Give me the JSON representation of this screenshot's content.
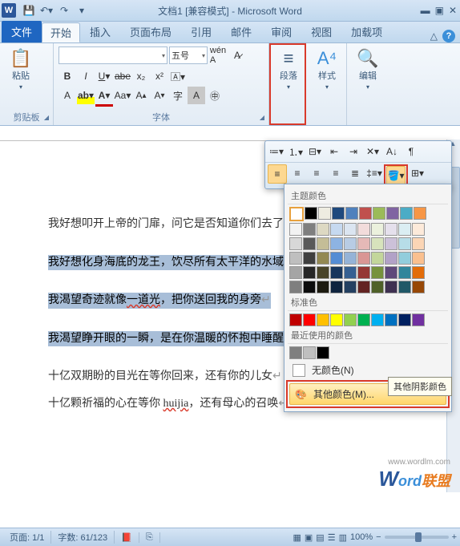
{
  "title": "文档1 [兼容模式] - Microsoft Word",
  "tabs": {
    "file": "文件",
    "home": "开始",
    "insert": "插入",
    "layout": "页面布局",
    "references": "引用",
    "mailings": "邮件",
    "review": "审阅",
    "view": "视图",
    "addins": "加载项"
  },
  "ribbon": {
    "clipboard": {
      "label": "剪贴板",
      "paste": "粘贴"
    },
    "font": {
      "label": "字体",
      "name": "",
      "size": "五号"
    },
    "paragraph": {
      "label": "段落"
    },
    "styles": {
      "label": "样式"
    },
    "editing": {
      "label": "编辑"
    }
  },
  "document": {
    "lines": [
      "我好想叩开上帝的门扉，问它是否知道你们去了何方",
      "我好想化身海底的龙王，饮尽所有太平洋的水域",
      "我渴望奇迹就像一道光，把你送回我的身旁",
      "我渴望睁开眼的一瞬，是在你温暖的怀抱中睡醒",
      "十亿双期盼的目光在等你回来，还有你的儿女",
      "十亿颗祈福的心在等你 huijia，还有母心的召唤"
    ]
  },
  "color_popup": {
    "theme_label": "主题颜色",
    "standard_label": "标准色",
    "recent_label": "最近使用的颜色",
    "no_color": "无颜色(N)",
    "more_colors": "其他颜色(M)...",
    "tooltip": "其他阴影颜色",
    "theme_row1": [
      "#ffffff",
      "#000000",
      "#eeece1",
      "#1f497d",
      "#4f81bd",
      "#c0504d",
      "#9bbb59",
      "#8064a2",
      "#4bacc6",
      "#f79646"
    ],
    "theme_shades": [
      [
        "#f2f2f2",
        "#7f7f7f",
        "#ddd9c3",
        "#c6d9f0",
        "#dbe5f1",
        "#f2dcdb",
        "#ebf1dd",
        "#e5e0ec",
        "#dbeef3",
        "#fdeada"
      ],
      [
        "#d8d8d8",
        "#595959",
        "#c4bd97",
        "#8db3e2",
        "#b8cce4",
        "#e5b9b7",
        "#d7e3bc",
        "#ccc1d9",
        "#b7dde8",
        "#fbd5b5"
      ],
      [
        "#bfbfbf",
        "#3f3f3f",
        "#938953",
        "#548dd4",
        "#95b3d7",
        "#d99694",
        "#c3d69b",
        "#b2a2c7",
        "#92cddc",
        "#fac08f"
      ],
      [
        "#a5a5a5",
        "#262626",
        "#494429",
        "#17365d",
        "#366092",
        "#953734",
        "#76923c",
        "#5f497a",
        "#31859b",
        "#e36c09"
      ],
      [
        "#7f7f7f",
        "#0c0c0c",
        "#1d1b10",
        "#0f243e",
        "#244061",
        "#632423",
        "#4f6128",
        "#3f3151",
        "#205867",
        "#974806"
      ]
    ],
    "standard": [
      "#c00000",
      "#ff0000",
      "#ffc000",
      "#ffff00",
      "#92d050",
      "#00b050",
      "#00b0f0",
      "#0070c0",
      "#002060",
      "#7030a0"
    ],
    "recent": [
      "#7f7f7f",
      "#bfbfbf",
      "#000000"
    ]
  },
  "status": {
    "page": "页面: 1/1",
    "words": "字数: 61/123",
    "zoom": "100%"
  },
  "watermark": {
    "url": "www.wordlm.com",
    "w": "W",
    "ord": "ord",
    "cn": "联盟"
  }
}
